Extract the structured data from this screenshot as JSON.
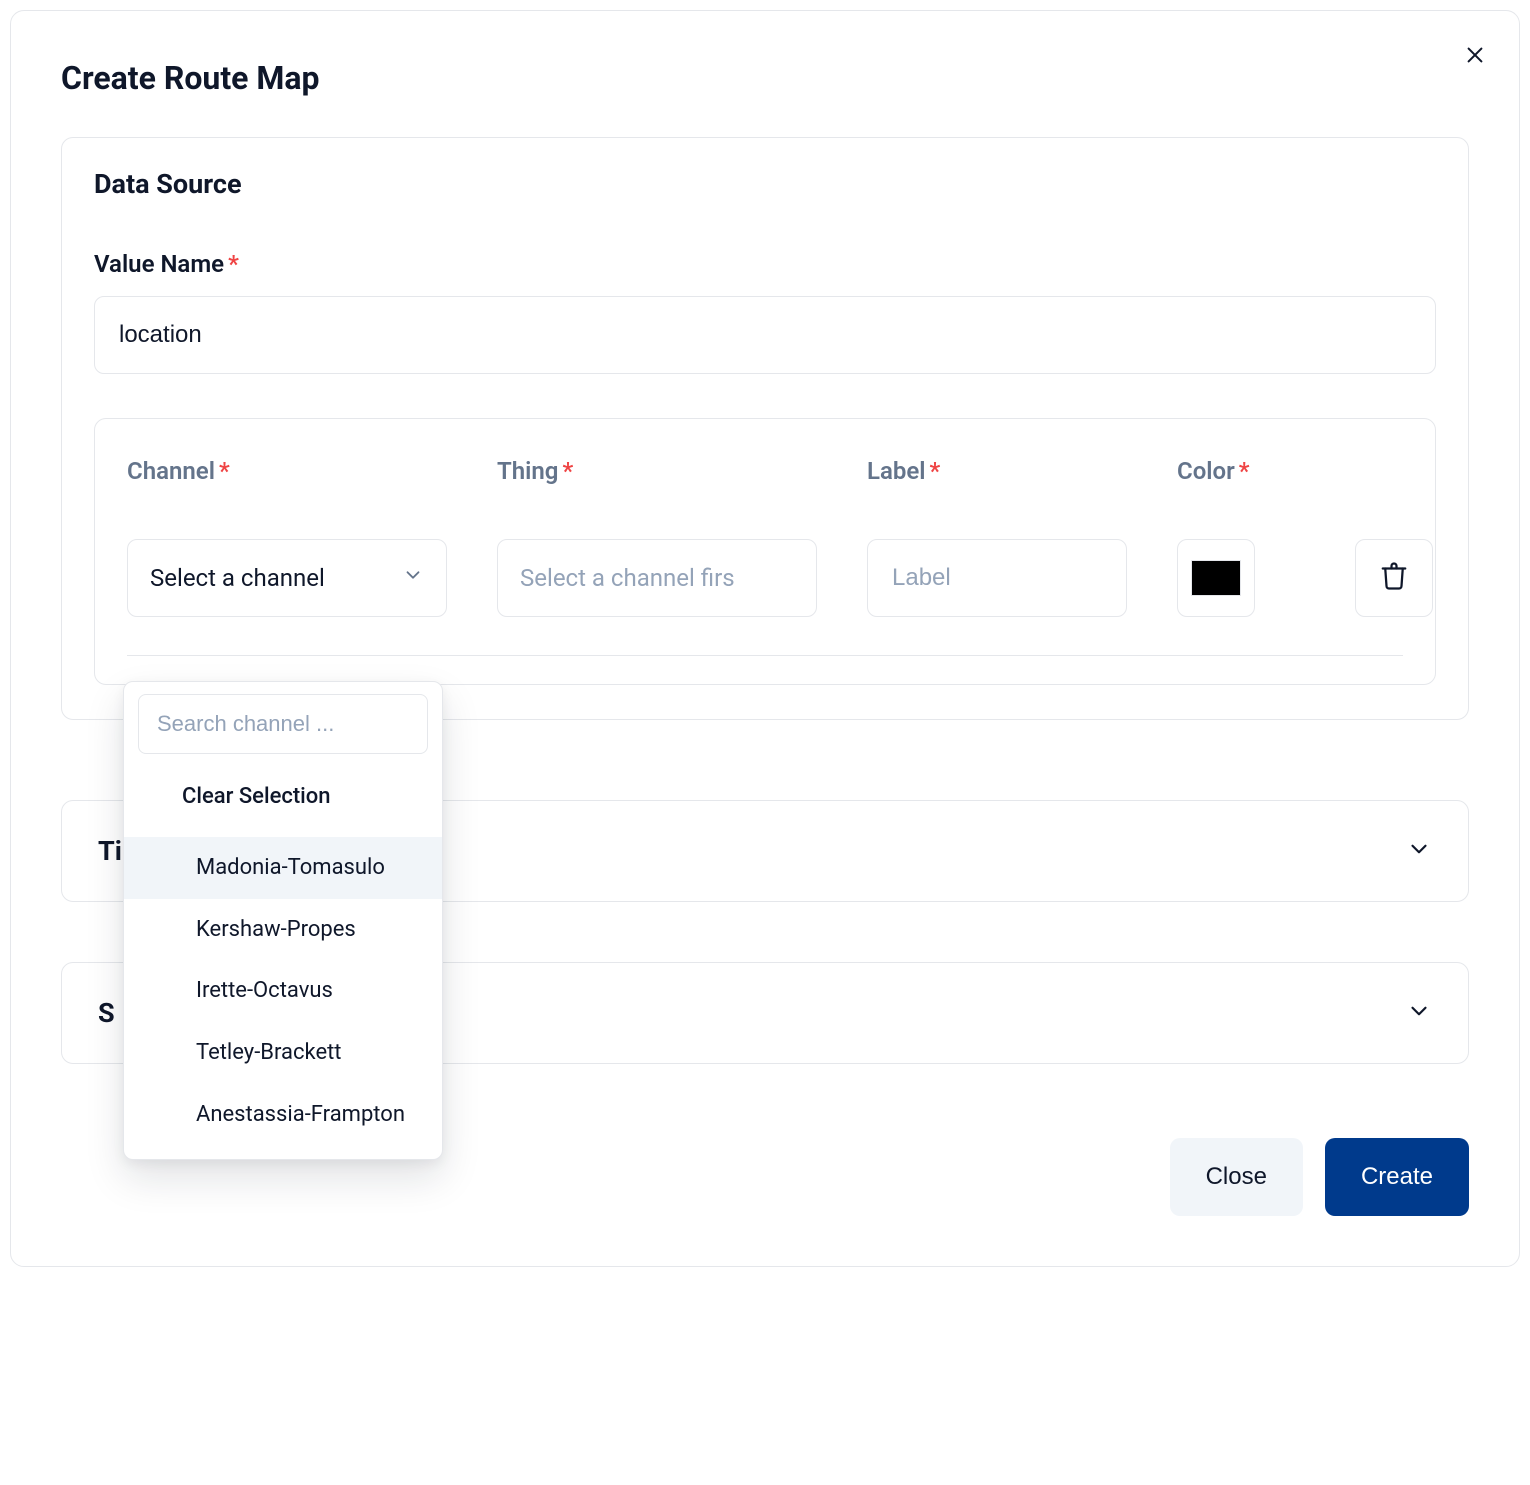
{
  "modal": {
    "title": "Create Route Map"
  },
  "dataSource": {
    "section_title": "Data Source",
    "valueName": {
      "label": "Value Name",
      "value": "location"
    },
    "channel": {
      "label": "Channel",
      "placeholder": "Select a channel",
      "search_placeholder": "Search channel ...",
      "clear_label": "Clear Selection",
      "options": [
        "Madonia-Tomasulo",
        "Kershaw-Propes",
        "Irette-Octavus",
        "Tetley-Brackett",
        "Anestassia-Frampton"
      ]
    },
    "thing": {
      "label": "Thing",
      "placeholder": "Select a channel firs"
    },
    "label": {
      "label": "Label",
      "placeholder": "Label"
    },
    "color": {
      "label": "Color",
      "value": "#000000"
    }
  },
  "sections": {
    "time_label_prefix": "Ti",
    "settings_label_prefix": "S"
  },
  "footer": {
    "close_label": "Close",
    "create_label": "Create"
  }
}
